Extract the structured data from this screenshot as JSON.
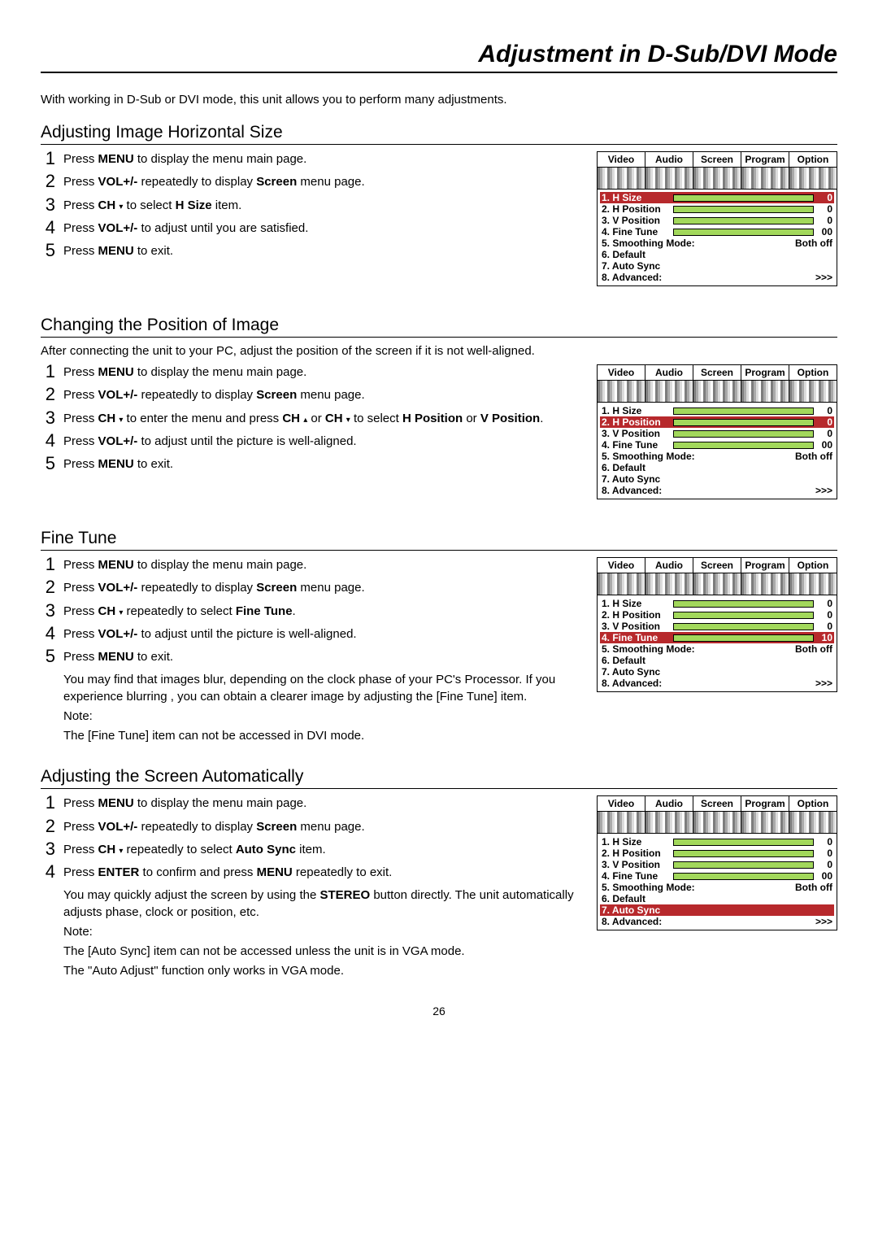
{
  "pageTitle": "Adjustment in D-Sub/DVI Mode",
  "intro": "With working in D-Sub or DVI mode, this unit allows you to perform many adjustments.",
  "pageNumber": "26",
  "osdTabs": [
    "Video",
    "Audio",
    "Screen",
    "Program",
    "Option"
  ],
  "sections": [
    {
      "title": "Adjusting Image Horizontal Size",
      "subtext": "",
      "steps": [
        "Press <b>MENU</b> to display the menu main page.",
        "Press <b>VOL+/-</b> repeatedly to display <b>Screen</b> menu page.",
        "Press <b>CH</b> <span class='arrow'>▾</span> to select  <b>H Size</b> item.",
        "Press <b>VOL+/-</b> to adjust until you are satisfied.",
        "Press <b>MENU</b> to exit."
      ],
      "notes": [],
      "osd": {
        "rows": [
          {
            "label": "1. H Size",
            "slider": true,
            "val": "0",
            "sel": true
          },
          {
            "label": "2. H Position",
            "slider": true,
            "val": "0"
          },
          {
            "label": "3. V Position",
            "slider": true,
            "val": "0"
          },
          {
            "label": "4. Fine Tune",
            "slider": true,
            "val": "00"
          },
          {
            "label": "5. Smoothing Mode:",
            "full": true,
            "right": "Both off"
          },
          {
            "label": "6. Default",
            "full": true,
            "right": ""
          },
          {
            "label": "7. Auto Sync",
            "full": true,
            "right": ""
          },
          {
            "label": "8. Advanced:",
            "full": true,
            "right": ">>>"
          }
        ]
      }
    },
    {
      "title": "Changing the Position of Image",
      "subtext": "After connecting the unit to your PC, adjust the position of the screen if it is not well-aligned.",
      "steps": [
        "Press <b>MENU</b> to display the menu main page.",
        "Press <b>VOL+/-</b> repeatedly to display <b>Screen</b> menu page.",
        "Press <b>CH</b> <span class='arrow'>▾</span> to enter the menu and press <b>CH</b> <span class='arrow'>▴</span> or <b>CH</b> <span class='arrow'>▾</span> to select <b>H Position</b> or <b>V Position</b>.",
        "Press <b>VOL+/-</b> to adjust until the picture is well-aligned.",
        "Press <b>MENU</b> to exit."
      ],
      "notes": [],
      "osd": {
        "rows": [
          {
            "label": "1. H Size",
            "slider": true,
            "val": "0"
          },
          {
            "label": "2. H Position",
            "slider": true,
            "val": "0",
            "sel": true
          },
          {
            "label": "3. V Position",
            "slider": true,
            "val": "0"
          },
          {
            "label": "4. Fine Tune",
            "slider": true,
            "val": "00"
          },
          {
            "label": "5. Smoothing Mode:",
            "full": true,
            "right": "Both off"
          },
          {
            "label": "6. Default",
            "full": true,
            "right": ""
          },
          {
            "label": "7. Auto Sync",
            "full": true,
            "right": ""
          },
          {
            "label": "8. Advanced:",
            "full": true,
            "right": ">>>"
          }
        ]
      }
    },
    {
      "title": "Fine Tune",
      "subtext": "",
      "steps": [
        "Press <b>MENU</b> to display the menu main page.",
        "Press <b>VOL+/-</b> repeatedly to display <b>Screen</b> menu page.",
        "Press <b>CH</b> <span class='arrow'>▾</span> repeatedly to select <b>Fine Tune</b>.",
        "Press <b>VOL+/-</b> to adjust until the picture is well-aligned.",
        "Press <b>MENU</b> to exit."
      ],
      "notes": [
        "You may find that images blur, depending on the clock phase of your PC's Processor. If you experience blurring , you can obtain a clearer image by adjusting the [Fine Tune] item.",
        "Note:",
        "The [Fine Tune] item can not be accessed in DVI mode."
      ],
      "osd": {
        "rows": [
          {
            "label": "1. H Size",
            "slider": true,
            "val": "0"
          },
          {
            "label": "2. H Position",
            "slider": true,
            "val": "0"
          },
          {
            "label": "3. V Position",
            "slider": true,
            "val": "0"
          },
          {
            "label": "4. Fine Tune",
            "slider": true,
            "val": "10",
            "sel": true
          },
          {
            "label": "5. Smoothing Mode:",
            "full": true,
            "right": "Both off"
          },
          {
            "label": "6. Default",
            "full": true,
            "right": ""
          },
          {
            "label": "7. Auto Sync",
            "full": true,
            "right": ""
          },
          {
            "label": "8. Advanced:",
            "full": true,
            "right": ">>>"
          }
        ]
      }
    },
    {
      "title": "Adjusting the Screen Automatically",
      "subtext": "",
      "steps": [
        "Press <b>MENU</b> to display the menu main page.",
        "Press <b>VOL+/-</b> repeatedly to display <b>Screen</b> menu page.",
        "Press <b>CH</b> <span class='arrow'>▾</span> repeatedly to select <b>Auto Sync</b> item.",
        "Press <b>ENTER</b> to confirm and press <b>MENU</b> repeatedly to exit."
      ],
      "notes": [
        "You may quickly adjust the screen by using the <b>STEREO</b> button directly. The unit automatically adjusts phase, clock or position, etc.",
        "Note:",
        "The [Auto Sync] item can not be accessed unless the unit is in VGA mode.",
        "The \"Auto Adjust\" function only works in VGA mode."
      ],
      "osd": {
        "rows": [
          {
            "label": "1. H Size",
            "slider": true,
            "val": "0"
          },
          {
            "label": "2. H Position",
            "slider": true,
            "val": "0"
          },
          {
            "label": "3. V Position",
            "slider": true,
            "val": "0"
          },
          {
            "label": "4. Fine Tune",
            "slider": true,
            "val": "00"
          },
          {
            "label": "5. Smoothing Mode:",
            "full": true,
            "right": "Both off"
          },
          {
            "label": "6. Default",
            "full": true,
            "right": ""
          },
          {
            "label": "7. Auto Sync",
            "full": true,
            "right": "",
            "sel": true
          },
          {
            "label": "8. Advanced:",
            "full": true,
            "right": ">>>"
          }
        ]
      }
    }
  ]
}
